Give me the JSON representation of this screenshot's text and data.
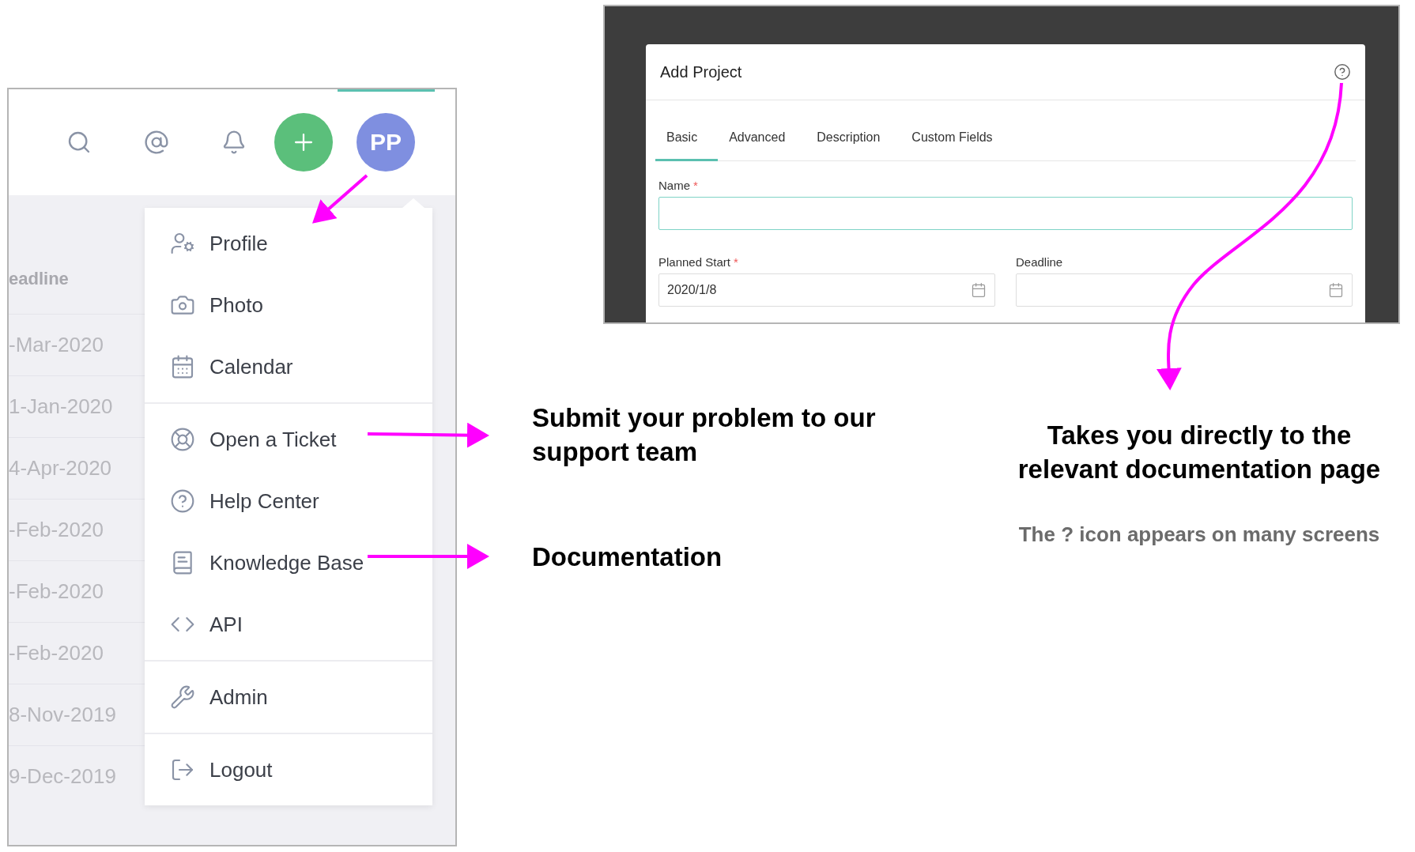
{
  "app_panel": {
    "header": {
      "avatar": "PP"
    },
    "dates_column": {
      "heading": "eadline",
      "cells": [
        "-Mar-2020",
        "1-Jan-2020",
        "4-Apr-2020",
        "-Feb-2020",
        "-Feb-2020",
        "-Feb-2020",
        "8-Nov-2019",
        "9-Dec-2019"
      ]
    },
    "menu": {
      "groups": [
        [
          {
            "label": "Profile",
            "kind": "profile"
          },
          {
            "label": "Photo",
            "kind": "photo"
          },
          {
            "label": "Calendar",
            "kind": "calendar"
          }
        ],
        [
          {
            "label": "Open a Ticket",
            "kind": "ticket"
          },
          {
            "label": "Help Center",
            "kind": "help"
          },
          {
            "label": "Knowledge Base",
            "kind": "book"
          },
          {
            "label": "API",
            "kind": "code"
          }
        ],
        [
          {
            "label": "Admin",
            "kind": "tools"
          }
        ],
        [
          {
            "label": "Logout",
            "kind": "logout"
          }
        ]
      ]
    }
  },
  "modal": {
    "title": "Add Project",
    "tabs": [
      {
        "label": "Basic",
        "selected": true
      },
      {
        "label": "Advanced",
        "selected": false
      },
      {
        "label": "Description",
        "selected": false
      },
      {
        "label": "Custom Fields",
        "selected": false
      }
    ],
    "fields": [
      {
        "label": "Name",
        "required_mark": "*",
        "focused": true,
        "kind": "text"
      },
      {
        "label": "Planned Start",
        "required_mark": "*",
        "focused": false,
        "kind": "date",
        "value": "2020/1/8"
      },
      {
        "label": "Deadline",
        "focused": false,
        "kind": "date"
      }
    ]
  },
  "annotations": [
    {
      "kind": "callout",
      "text": "Submit your problem to our support team"
    },
    {
      "kind": "callout",
      "text": "Documentation"
    },
    {
      "kind": "callout",
      "text": "Takes you directly to the relevant documentation page"
    },
    {
      "kind": "note",
      "text": "The ?  icon appears on many screens"
    }
  ]
}
